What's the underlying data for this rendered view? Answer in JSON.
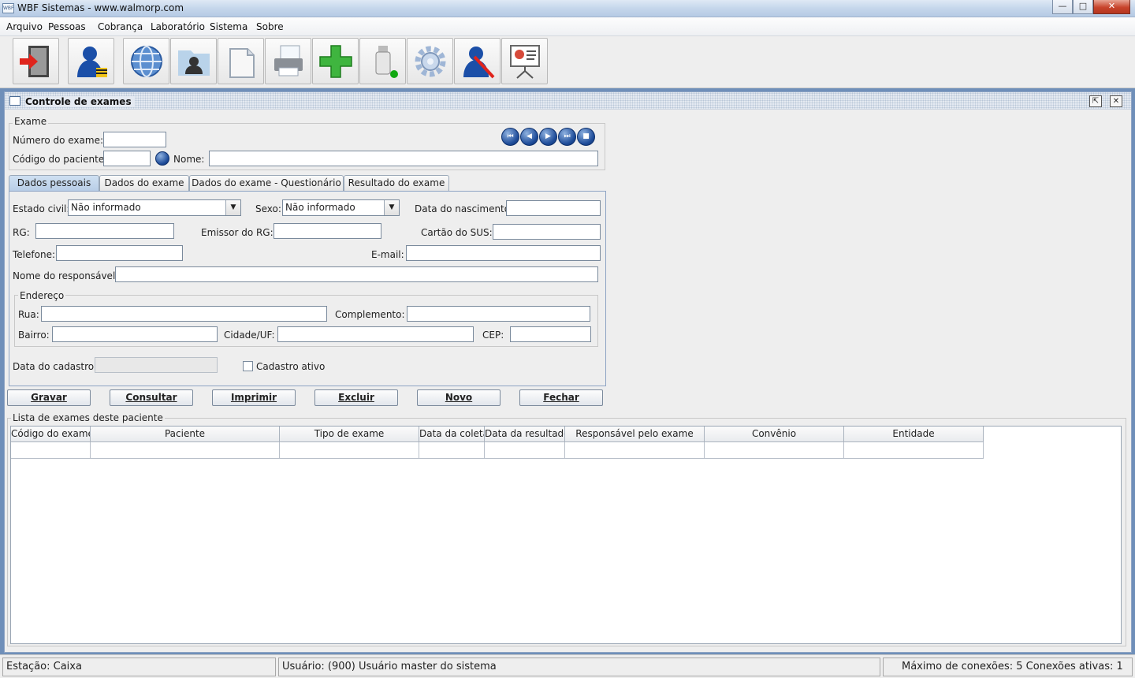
{
  "window": {
    "title": "WBF Sistemas - www.walmorp.com",
    "app_icon_text": "WBF",
    "min": "—",
    "max": "□",
    "close": "✕"
  },
  "menu": [
    "Arquivo",
    "Pessoas",
    "Cobrança",
    "Laboratório",
    "Sistema",
    "Sobre"
  ],
  "toolbar": [
    "exit-icon",
    "user-lock-icon",
    "globe-icon",
    "contacts-folder-icon",
    "document-icon",
    "printer-icon",
    "add-icon",
    "usb-drive-icon",
    "settings-gear-icon",
    "user-edit-icon",
    "presentation-icon"
  ],
  "internal_frame": {
    "title": "Controle de exames",
    "detach": "⇱",
    "close": "✕"
  },
  "exame": {
    "legend": "Exame",
    "numero_label": "Número do exame:",
    "numero_value": "",
    "codigo_label": "Código do paciente:",
    "codigo_value": "",
    "nome_label": "Nome:",
    "nome_value": "",
    "nav": [
      "⏮",
      "◀",
      "▶",
      "⏭",
      "■"
    ]
  },
  "tabs": [
    "Dados pessoais",
    "Dados do exame",
    "Dados do exame - Questionário",
    "Resultado do exame"
  ],
  "dados_pessoais": {
    "estado_civil_label": "Estado civil:",
    "estado_civil_value": "Não informado",
    "sexo_label": "Sexo:",
    "sexo_value": "Não informado",
    "nascimento_label": "Data do nascimento:",
    "rg_label": "RG:",
    "emissor_label": "Emissor do RG:",
    "sus_label": "Cartão do SUS:",
    "telefone_label": "Telefone:",
    "email_label": "E-mail:",
    "responsavel_label": "Nome do responsável:",
    "endereco_legend": "Endereço",
    "rua_label": "Rua:",
    "complemento_label": "Complemento:",
    "bairro_label": "Bairro:",
    "cidade_label": "Cidade/UF:",
    "cep_label": "CEP:",
    "cadastro_label": "Data do cadastro:",
    "ativo_label": "Cadastro ativo"
  },
  "actions": [
    "Gravar",
    "Consultar",
    "Imprimir",
    "Excluir",
    "Novo",
    "Fechar"
  ],
  "lista": {
    "legend": "Lista de exames deste paciente",
    "columns": [
      "Código do exame",
      "Paciente",
      "Tipo de exame",
      "Data da coleta",
      "Data da resultado",
      "Responsável pelo exame",
      "Convênio",
      "Entidade"
    ]
  },
  "status": {
    "estacao": "Estação: Caixa",
    "usuario": "Usuário: (900) Usuário master do sistema",
    "conexoes": "Máximo de conexões: 5 Conexões ativas: 1"
  }
}
